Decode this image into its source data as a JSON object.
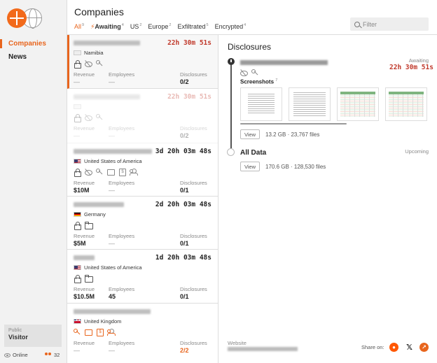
{
  "sidebar": {
    "nav": [
      {
        "label": "Companies"
      },
      {
        "label": "News"
      }
    ],
    "visitor": {
      "label": "Public",
      "value": "Visitor"
    },
    "online_label": "Online",
    "user_count": "32"
  },
  "header": {
    "title": "Companies",
    "tabs": [
      {
        "label": "All",
        "count": "9"
      },
      {
        "label": "Awaiting",
        "count": "4"
      },
      {
        "label": "US",
        "count": "2"
      },
      {
        "label": "Europe",
        "count": "2"
      },
      {
        "label": "Exfiltrated",
        "count": "5"
      },
      {
        "label": "Encrypted",
        "count": "4"
      }
    ],
    "filter_placeholder": "Filter"
  },
  "labels": {
    "revenue": "Revenue",
    "employees": "Employees",
    "disclosures": "Disclosures"
  },
  "companies": [
    {
      "timer": "22h 30m 51s",
      "country": "Namibia",
      "revenue": "—",
      "employees": "—",
      "disclosures": "0/2"
    },
    {
      "timer": "22h 30m 51s",
      "country": "",
      "revenue": "—",
      "employees": "—",
      "disclosures": "0/2"
    },
    {
      "timer": "3d 20h 03m 48s",
      "country": "United States of America",
      "revenue": "$10M",
      "employees": "—",
      "disclosures": "0/1"
    },
    {
      "timer": "2d 20h 03m 48s",
      "country": "Germany",
      "revenue": "$5M",
      "employees": "—",
      "disclosures": "0/1"
    },
    {
      "timer": "1d 20h 03m 48s",
      "country": "United States of America",
      "revenue": "$10.5M",
      "employees": "45",
      "disclosures": "0/1"
    },
    {
      "timer": "",
      "country": "United Kingdom",
      "revenue": "—",
      "employees": "—",
      "disclosures": "2/2"
    }
  ],
  "detail": {
    "title": "Disclosures",
    "first": {
      "status": "Awaiting",
      "timer": "22h 30m 51s",
      "screenshots_label": "Screenshots",
      "screenshots_count": "7",
      "view": "View",
      "size": "13.2 GB · 23,767 files"
    },
    "all_data": {
      "label": "All Data",
      "status": "Upcoming",
      "view": "View",
      "size": "170.6 GB · 128,530 files"
    },
    "website_label": "Website",
    "share_label": "Share on:"
  }
}
